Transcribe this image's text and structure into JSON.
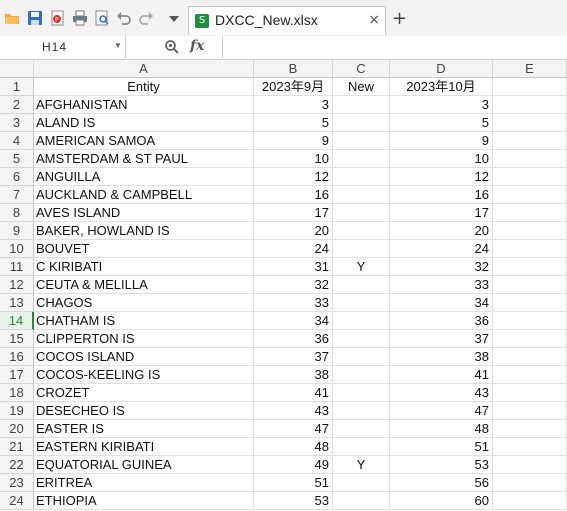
{
  "toolbar": {
    "icons": [
      "open-folder-icon",
      "save-icon",
      "export-pdf-icon",
      "print-icon",
      "print-preview-icon",
      "undo-icon",
      "redo-icon",
      "dropdown-icon"
    ]
  },
  "tab": {
    "title": "DXCC_New.xlsx",
    "close": "×",
    "new": "+"
  },
  "formula_bar": {
    "name_box": "H14",
    "fx": "fx",
    "content": ""
  },
  "columns": [
    "A",
    "B",
    "C",
    "D",
    "E"
  ],
  "rows": [
    {
      "n": "1",
      "a": "Entity",
      "b": "2023年9月",
      "c": "New",
      "d": "2023年10月"
    },
    {
      "n": "2",
      "a": "AFGHANISTAN",
      "b": "3",
      "c": "",
      "d": "3"
    },
    {
      "n": "3",
      "a": "ALAND IS",
      "b": "5",
      "c": "",
      "d": "5"
    },
    {
      "n": "4",
      "a": "AMERICAN SAMOA",
      "b": "9",
      "c": "",
      "d": "9"
    },
    {
      "n": "5",
      "a": "AMSTERDAM & ST PAUL",
      "b": "10",
      "c": "",
      "d": "10"
    },
    {
      "n": "6",
      "a": "ANGUILLA",
      "b": "12",
      "c": "",
      "d": "12"
    },
    {
      "n": "7",
      "a": "AUCKLAND & CAMPBELL",
      "b": "16",
      "c": "",
      "d": "16"
    },
    {
      "n": "8",
      "a": "AVES ISLAND",
      "b": "17",
      "c": "",
      "d": "17"
    },
    {
      "n": "9",
      "a": "BAKER, HOWLAND IS",
      "b": "20",
      "c": "",
      "d": "20"
    },
    {
      "n": "10",
      "a": "BOUVET",
      "b": "24",
      "c": "",
      "d": "24"
    },
    {
      "n": "11",
      "a": "C KIRIBATI",
      "b": "31",
      "c": "Y",
      "d": "32"
    },
    {
      "n": "12",
      "a": "CEUTA & MELILLA",
      "b": "32",
      "c": "",
      "d": "33"
    },
    {
      "n": "13",
      "a": "CHAGOS",
      "b": "33",
      "c": "",
      "d": "34"
    },
    {
      "n": "14",
      "a": "CHATHAM IS",
      "b": "34",
      "c": "",
      "d": "36"
    },
    {
      "n": "15",
      "a": "CLIPPERTON IS",
      "b": "36",
      "c": "",
      "d": "37"
    },
    {
      "n": "16",
      "a": "COCOS ISLAND",
      "b": "37",
      "c": "",
      "d": "38"
    },
    {
      "n": "17",
      "a": "COCOS-KEELING IS",
      "b": "38",
      "c": "",
      "d": "41"
    },
    {
      "n": "18",
      "a": "CROZET",
      "b": "41",
      "c": "",
      "d": "43"
    },
    {
      "n": "19",
      "a": "DESECHEO IS",
      "b": "43",
      "c": "",
      "d": "47"
    },
    {
      "n": "20",
      "a": "EASTER IS",
      "b": "47",
      "c": "",
      "d": "48"
    },
    {
      "n": "21",
      "a": "EASTERN KIRIBATI",
      "b": "48",
      "c": "",
      "d": "51"
    },
    {
      "n": "22",
      "a": "EQUATORIAL GUINEA",
      "b": "49",
      "c": "Y",
      "d": "53"
    },
    {
      "n": "23",
      "a": "ERITREA",
      "b": "51",
      "c": "",
      "d": "56"
    },
    {
      "n": "24",
      "a": "ETHIOPIA",
      "b": "53",
      "c": "",
      "d": "60"
    }
  ],
  "active_row": "14",
  "colors": {
    "accent": "#1e8e3e",
    "header_bg": "#f4f4f4"
  }
}
